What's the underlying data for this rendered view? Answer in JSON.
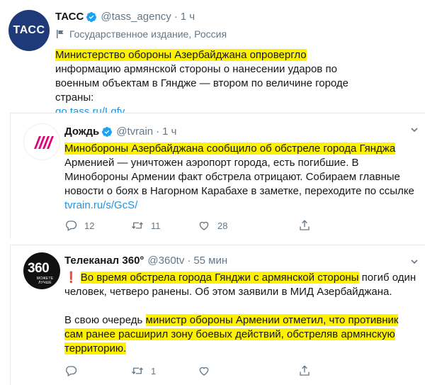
{
  "tweets": [
    {
      "name": "ТАСС",
      "handle": "@tass_agency",
      "dot": "·",
      "time": "1 ч",
      "avatar_text": "ТАСС",
      "org_label": "Государственное издание, Россия",
      "highlight": "Министерство обороны Азербайджана опровергло",
      "text_rest": " информацию армянской стороны о нанесении ударов по военным объектам в Гяндже — втором по величине городе страны:",
      "link": "go.tass.ru/Lgfv"
    },
    {
      "name": "Дождь",
      "handle": "@tvrain",
      "dot": "·",
      "time": "1 ч",
      "highlight": "Минобороны Азербайджана сообщило об обстреле города Гянджа",
      "text_rest": " Арменией — уничтожен аэропорт города, есть погибшие. В Минобороны Армении факт обстрела отрицают. Собираем главные новости о боях в Нагорном Карабахе в заметке, переходите по ссылке",
      "link": "tvrain.ru/s/GcS/",
      "replies": "12",
      "retweets": "11",
      "likes": "28"
    },
    {
      "name": "Телеканал 360°",
      "handle": "@360tv",
      "dot": "·",
      "time": "55 мин",
      "avatar_num": "360",
      "avatar_sub": "МОЖЕТЕ ЛУЧШЕ",
      "warn": "❗",
      "highlight1": "Во время обстрела города Гянджи с армянской стороны",
      "text1_rest": " погиб один человек, четверо ранены. Об этом заявили в МИД Азербайджана.",
      "text2_pre": "В свою очередь ",
      "highlight2": "министр обороны Армении отметил, что противник сам ранее расширил зону боевых действий, обстреляв армянскую территорию.",
      "replies": "",
      "retweets": "1",
      "likes": ""
    }
  ],
  "colors": {
    "highlight": "#fff200",
    "link": "#1b95e0",
    "verified": "#1da1f2",
    "muted": "#657786"
  },
  "icons": [
    "verified-badge-icon",
    "org-flag-icon",
    "more-chevron-icon",
    "reply-icon",
    "retweet-icon",
    "like-icon",
    "share-icon"
  ]
}
